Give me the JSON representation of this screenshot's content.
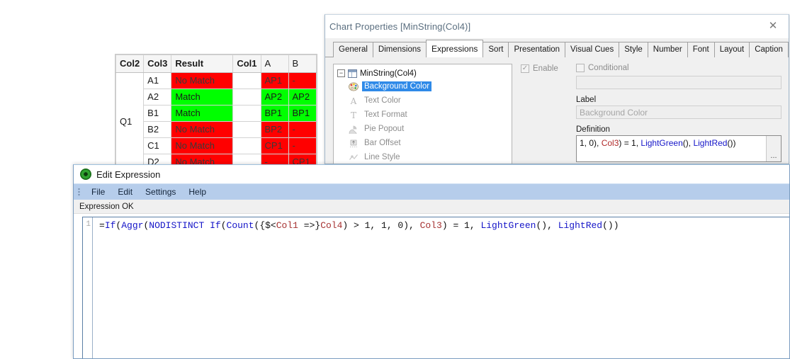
{
  "pivot_table": {
    "headers": [
      "Col2",
      "Col3",
      "Result",
      "Col1",
      "A",
      "B"
    ],
    "dimension_value": "Q1",
    "rows": [
      {
        "col3": "A1",
        "result": "No Match",
        "result_state": "red",
        "a": "AP1",
        "a_state": "red",
        "b": "-",
        "b_state": "red"
      },
      {
        "col3": "A2",
        "result": "Match",
        "result_state": "green",
        "a": "AP2",
        "a_state": "green",
        "b": "AP2",
        "b_state": "green"
      },
      {
        "col3": "B1",
        "result": "Match",
        "result_state": "green",
        "a": "BP1",
        "a_state": "green",
        "b": "BP1",
        "b_state": "green"
      },
      {
        "col3": "B2",
        "result": "No Match",
        "result_state": "red",
        "a": "BP2",
        "a_state": "red",
        "b": "-",
        "b_state": "red"
      },
      {
        "col3": "C1",
        "result": "No Match",
        "result_state": "red",
        "a": "CP1",
        "a_state": "red",
        "b": "-",
        "b_state": "red"
      },
      {
        "col3": "D2",
        "result": "No Match",
        "result_state": "red",
        "a": "-",
        "a_state": "red",
        "b": "CP1",
        "b_state": "red"
      }
    ],
    "colors": {
      "match": "#00ff00",
      "no_match": "#ff0000"
    }
  },
  "chart_properties": {
    "title": "Chart Properties [MinString(Col4)]",
    "close_label": "✕",
    "tabs": [
      {
        "label": "General",
        "active": false
      },
      {
        "label": "Dimensions",
        "active": false
      },
      {
        "label": "Expressions",
        "active": true
      },
      {
        "label": "Sort",
        "active": false
      },
      {
        "label": "Presentation",
        "active": false
      },
      {
        "label": "Visual Cues",
        "active": false
      },
      {
        "label": "Style",
        "active": false
      },
      {
        "label": "Number",
        "active": false
      },
      {
        "label": "Font",
        "active": false
      },
      {
        "label": "Layout",
        "active": false
      },
      {
        "label": "Caption",
        "active": false
      }
    ],
    "tree": {
      "root_label": "MinString(Col4)",
      "toggle": "−",
      "items": [
        {
          "label": "Background Color",
          "selected": true,
          "icon": "palette-icon"
        },
        {
          "label": "Text Color",
          "selected": false,
          "icon": "text-color-icon"
        },
        {
          "label": "Text Format",
          "selected": false,
          "icon": "text-format-icon"
        },
        {
          "label": "Pie Popout",
          "selected": false,
          "icon": "pie-popout-icon"
        },
        {
          "label": "Bar Offset",
          "selected": false,
          "icon": "bar-offset-icon"
        },
        {
          "label": "Line Style",
          "selected": false,
          "icon": "line-style-icon"
        }
      ]
    },
    "enable_checkbox": {
      "label": "Enable",
      "checked": true
    },
    "conditional_checkbox": {
      "label": "Conditional",
      "checked": false
    },
    "conditional_value": "",
    "label_field": {
      "caption": "Label",
      "value": "Background Color"
    },
    "definition_field": {
      "caption": "Definition",
      "value": "1, 0), Col3) = 1, LightGreen(), LightRed())",
      "browse_button": "..."
    }
  },
  "edit_expression": {
    "title": "Edit Expression",
    "menu": [
      "File",
      "Edit",
      "Settings",
      "Help"
    ],
    "status": "Expression OK",
    "line_number": "1",
    "expression": "=If(Aggr(NODISTINCT If(Count({$<Col1 =>}Col4) > 1, 1, 0), Col3) = 1, LightGreen(), LightRed())"
  }
}
